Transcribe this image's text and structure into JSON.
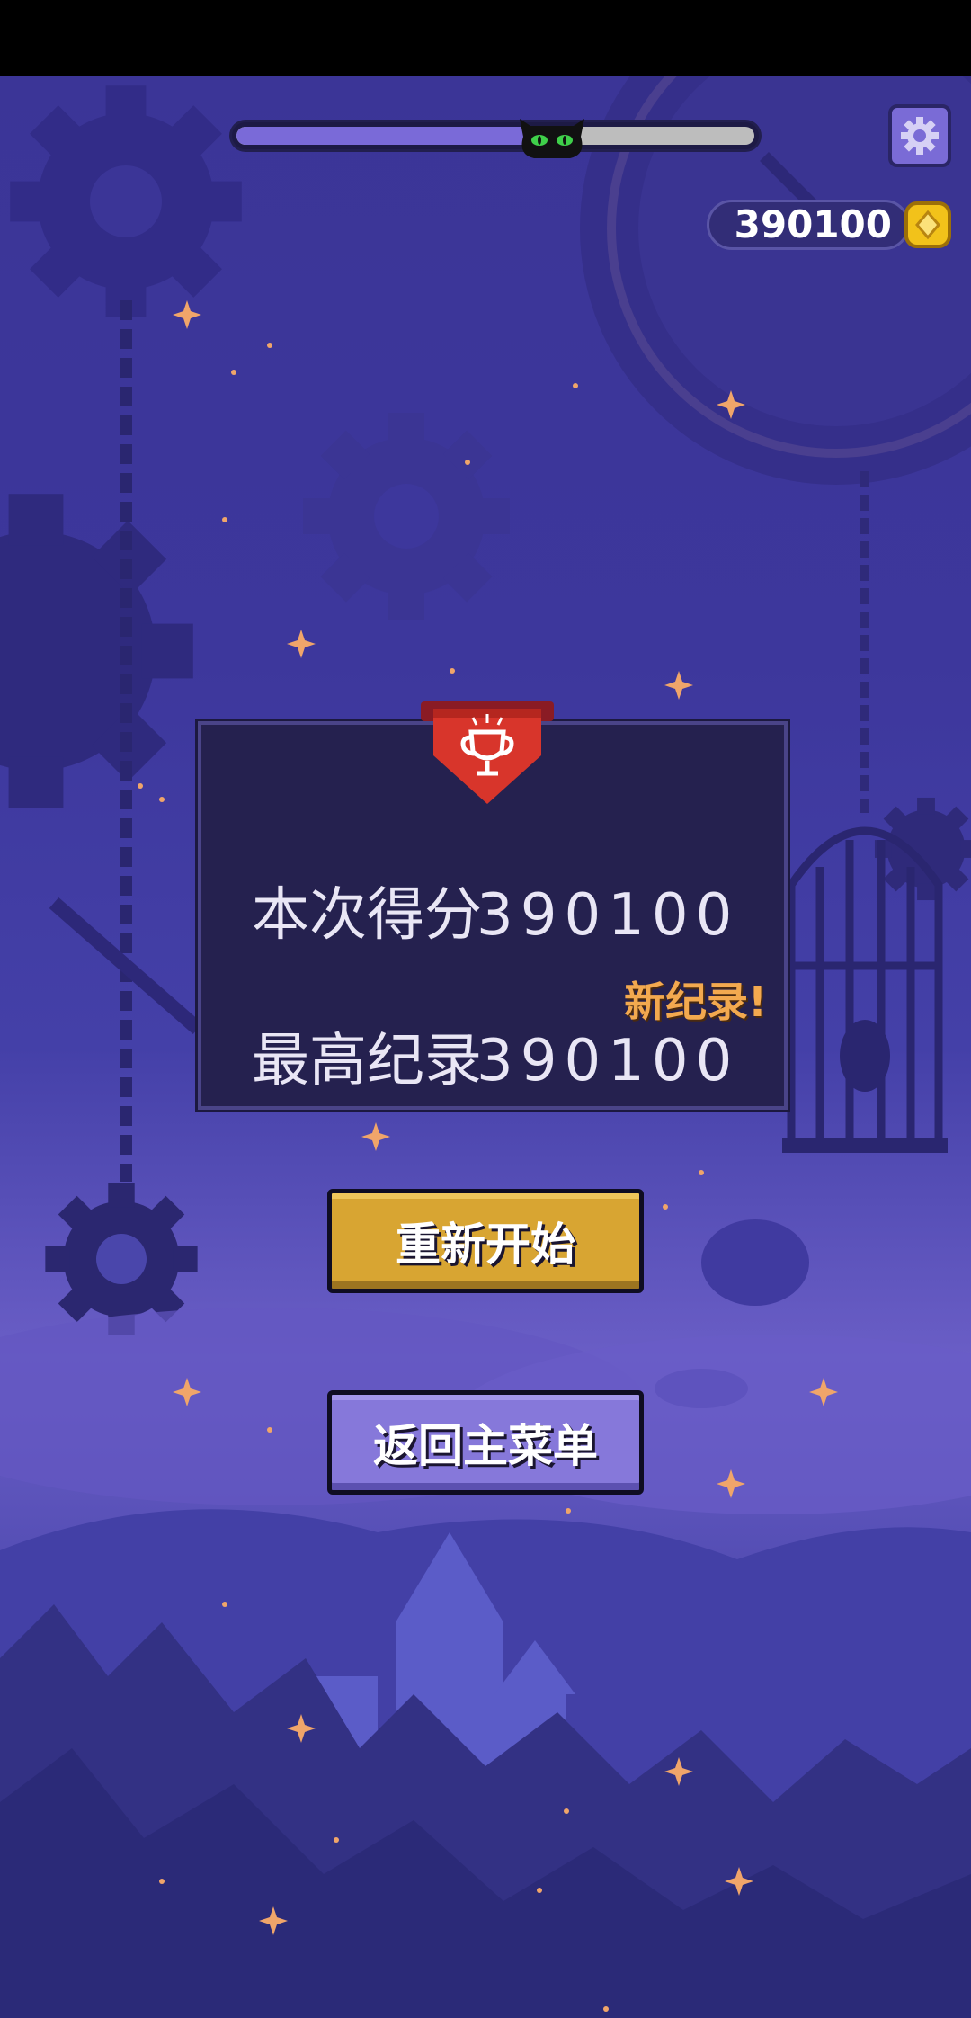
{
  "hud": {
    "progress_fraction": 0.61,
    "coins": "390100",
    "settings_icon": "gear-icon",
    "coin_icon": "coin-icon"
  },
  "result": {
    "score_label": "本次得分",
    "score_value": "390100",
    "new_record_label": "新纪录!",
    "best_label": "最高纪录",
    "best_value": "390100",
    "banner_icon": "trophy-icon"
  },
  "buttons": {
    "restart_label": "重新开始",
    "menu_label": "返回主菜单"
  },
  "colors": {
    "background": "#3d379c",
    "restart": "#d8a532",
    "menu": "#8678da",
    "new_record": "#f3a94f"
  }
}
